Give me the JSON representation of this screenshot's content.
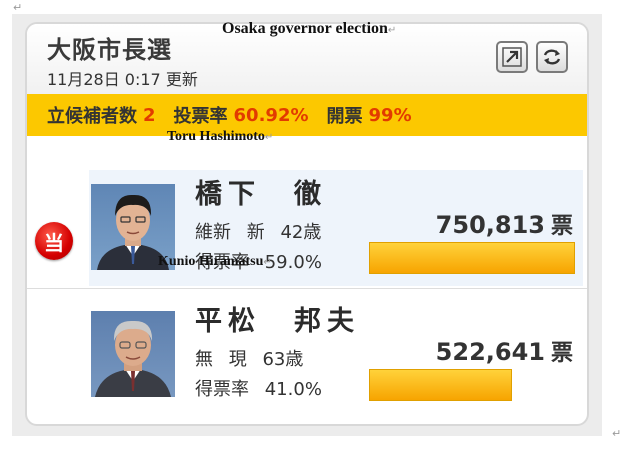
{
  "election": {
    "title": "大阪市長選",
    "updated": "11月28日 0:17 更新",
    "caption": "Osaka governor election"
  },
  "stats": {
    "candidates_label": "立候補者数",
    "candidates_value": "2",
    "turnout_label": "投票率",
    "turnout_value": "60.92%",
    "counted_label": "開票",
    "counted_value": "99%"
  },
  "candidates": [
    {
      "caption": "Toru Hashimoto",
      "name": "橋下　徹",
      "party": "維新",
      "status": "新",
      "age": "42歳",
      "rate_label": "得票率",
      "rate": "59.0%",
      "votes": "750,813",
      "votes_unit": "票",
      "winner_mark": "当",
      "bar_fraction": 1.0
    },
    {
      "caption": "Kunio Hiramatsu",
      "name": "平松　邦夫",
      "party": "無",
      "status": "現",
      "age": "63歳",
      "rate_label": "得票率",
      "rate": "41.0%",
      "votes": "522,641",
      "votes_unit": "票",
      "bar_fraction": 0.695
    }
  ],
  "icons": {
    "expand": "expand-arrow-icon",
    "refresh": "refresh-icon"
  },
  "colors": {
    "accent_bar": "#fcc800",
    "value_red": "#e23b00",
    "winner_red": "#d40000",
    "vote_bar": "#f7a400"
  }
}
